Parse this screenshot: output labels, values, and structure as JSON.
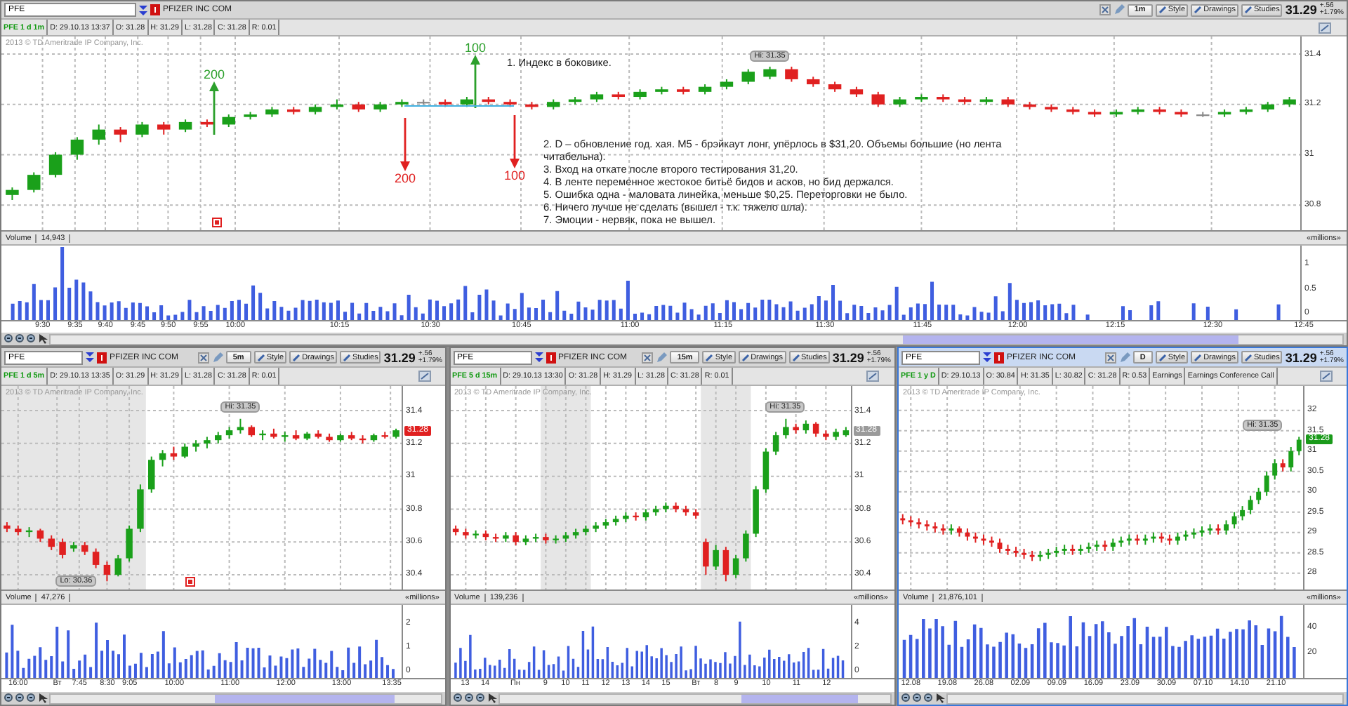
{
  "panels": [
    {
      "selected": false,
      "symbol": "PFE",
      "company": "PFIZER INC COM",
      "interval": "1m",
      "tools": [
        "Style",
        "Drawings",
        "Studies"
      ],
      "price": "31.29",
      "change": "+.56",
      "change_pct": "+1.79%",
      "info": [
        "PFE 1 d 1m",
        "D: 29.10.13 13:37",
        "O: 31.28",
        "H: 31.29",
        "L: 31.28",
        "C: 31.28",
        "R: 0.01"
      ],
      "copyright": "2013 © TD Ameritrade IP Company, Inc.",
      "hi_label": "Hi: 31.35",
      "chart_data": {
        "type": "candlestick",
        "grid": true,
        "ylim": [
          30.7,
          31.47
        ],
        "yticks": [
          31.4,
          31.2,
          31,
          30.8
        ],
        "categories": [
          null,
          null,
          null,
          null,
          null,
          null,
          null,
          null,
          null,
          null,
          null,
          null,
          null,
          null,
          null,
          null,
          null,
          null,
          null,
          null,
          null,
          null,
          null,
          null,
          null,
          null,
          null,
          null,
          null,
          null,
          null,
          null,
          null,
          null,
          null,
          null,
          null,
          null,
          null,
          null,
          null,
          null,
          null,
          null,
          null,
          null,
          null,
          null,
          null,
          null,
          null,
          null,
          null,
          null,
          null,
          null,
          null,
          null,
          null,
          null
        ],
        "ohlc": [
          [
            30.84,
            30.87,
            30.82,
            30.86
          ],
          [
            30.86,
            30.93,
            30.85,
            30.92
          ],
          [
            30.92,
            31.01,
            30.91,
            31.0
          ],
          [
            31.0,
            31.07,
            30.98,
            31.06
          ],
          [
            31.06,
            31.12,
            31.04,
            31.1
          ],
          [
            31.1,
            31.11,
            31.05,
            31.08
          ],
          [
            31.08,
            31.13,
            31.07,
            31.12
          ],
          [
            31.12,
            31.13,
            31.08,
            31.1
          ],
          [
            31.1,
            31.14,
            31.09,
            31.13
          ],
          [
            31.13,
            31.14,
            31.11,
            31.12
          ],
          [
            31.12,
            31.16,
            31.11,
            31.15
          ],
          [
            31.15,
            31.17,
            31.14,
            31.16
          ],
          [
            31.16,
            31.19,
            31.15,
            31.18
          ],
          [
            31.18,
            31.19,
            31.16,
            31.17
          ],
          [
            31.17,
            31.2,
            31.16,
            31.19
          ],
          [
            31.19,
            31.22,
            31.18,
            31.2
          ],
          [
            31.2,
            31.21,
            31.17,
            31.18
          ],
          [
            31.18,
            31.21,
            31.17,
            31.2
          ],
          [
            31.2,
            31.22,
            31.19,
            31.21
          ],
          [
            31.21,
            31.22,
            31.2,
            31.21
          ],
          [
            31.21,
            31.22,
            31.19,
            31.2
          ],
          [
            31.2,
            31.23,
            31.19,
            31.22
          ],
          [
            31.22,
            31.23,
            31.2,
            31.21
          ],
          [
            31.21,
            31.22,
            31.19,
            31.2
          ],
          [
            31.2,
            31.21,
            31.18,
            31.19
          ],
          [
            31.19,
            31.22,
            31.18,
            31.21
          ],
          [
            31.21,
            31.23,
            31.2,
            31.22
          ],
          [
            31.22,
            31.25,
            31.21,
            31.24
          ],
          [
            31.24,
            31.25,
            31.22,
            31.23
          ],
          [
            31.23,
            31.26,
            31.22,
            31.25
          ],
          [
            31.25,
            31.27,
            31.24,
            31.26
          ],
          [
            31.26,
            31.27,
            31.24,
            31.25
          ],
          [
            31.25,
            31.28,
            31.24,
            31.27
          ],
          [
            31.27,
            31.3,
            31.26,
            31.29
          ],
          [
            31.29,
            31.34,
            31.28,
            31.33
          ],
          [
            31.31,
            31.35,
            31.3,
            31.34
          ],
          [
            31.34,
            31.35,
            31.29,
            31.3
          ],
          [
            31.3,
            31.31,
            31.27,
            31.28
          ],
          [
            31.28,
            31.29,
            31.25,
            31.26
          ],
          [
            31.26,
            31.27,
            31.23,
            31.24
          ],
          [
            31.24,
            31.25,
            31.19,
            31.2
          ],
          [
            31.2,
            31.23,
            31.19,
            31.22
          ],
          [
            31.22,
            31.24,
            31.21,
            31.23
          ],
          [
            31.23,
            31.24,
            31.21,
            31.22
          ],
          [
            31.22,
            31.23,
            31.2,
            31.21
          ],
          [
            31.21,
            31.23,
            31.2,
            31.22
          ],
          [
            31.22,
            31.23,
            31.19,
            31.2
          ],
          [
            31.2,
            31.21,
            31.18,
            31.19
          ],
          [
            31.19,
            31.2,
            31.17,
            31.18
          ],
          [
            31.18,
            31.19,
            31.16,
            31.17
          ],
          [
            31.17,
            31.18,
            31.15,
            31.16
          ],
          [
            31.16,
            31.18,
            31.15,
            31.17
          ],
          [
            31.17,
            31.19,
            31.16,
            31.18
          ],
          [
            31.18,
            31.19,
            31.16,
            31.17
          ],
          [
            31.17,
            31.18,
            31.15,
            31.16
          ],
          [
            31.16,
            31.17,
            31.15,
            31.16
          ],
          [
            31.16,
            31.18,
            31.15,
            31.17
          ],
          [
            31.17,
            31.19,
            31.16,
            31.18
          ],
          [
            31.18,
            31.21,
            31.17,
            31.2
          ],
          [
            31.2,
            31.23,
            31.19,
            31.22
          ]
        ]
      },
      "volume_label": "Volume",
      "volume_value": "14,943",
      "volume_units": "«millions»",
      "volume_ticks": [
        "1",
        "0.5",
        "0"
      ],
      "time_ticks": [
        "9:30",
        "9:35",
        "9:40",
        "9:45",
        "9:50",
        "9:55",
        "10:00",
        "10:15",
        "10:30",
        "10:45",
        "11:00",
        "11:15",
        "11:30",
        "11:45",
        "12:00",
        "12:15",
        "12:30",
        "12:45"
      ],
      "arrows": [
        {
          "label": "200",
          "kind": "up",
          "color": "#2ca02c"
        },
        {
          "label": "100",
          "kind": "up",
          "color": "#2ca02c"
        },
        {
          "label": "200",
          "kind": "down",
          "color": "#e02020"
        },
        {
          "label": "100",
          "kind": "down",
          "color": "#e02020"
        }
      ],
      "notes": [
        "1. Индекс в боковике.",
        "2. D – обновление год. хая. M5 - брэйкаут лонг, упёрлось в $31,20. Объемы большие (но лента читабельна).",
        "3. Вход на откате после второго тестирования 31,20.",
        "4. В ленте переменное жестокое битьё бидов и асков, но бид держался.",
        "5. Ошибка одна - маловата линейка, меньше $0,25. Переторговки не было.",
        "6. Ничего лучше не сделать (вышел - т.к. тяжело шла).",
        "7. Эмоции - нервяк, пока не вышел."
      ]
    },
    {
      "selected": false,
      "symbol": "PFE",
      "company": "PFIZER INC COM",
      "interval": "5m",
      "tools": [
        "Style",
        "Drawings",
        "Studies"
      ],
      "price": "31.29",
      "change": "+.56",
      "change_pct": "+1.79%",
      "info": [
        "PFE 1 d 5m",
        "D: 29.10.13 13:35",
        "O: 31.29",
        "H: 31.29",
        "L: 31.28",
        "C: 31.28",
        "R: 0.01"
      ],
      "copyright": "2013 © TD Ameritrade IP Company, Inc.",
      "hi_label": "Hi: 31.35",
      "lo_label": "Lo: 30.36",
      "price_tag": {
        "text": "31.28",
        "color": "#e02020"
      },
      "chart_data": {
        "type": "candlestick",
        "grid": true,
        "ylim": [
          30.31,
          31.55
        ],
        "yticks": [
          31.4,
          31.2,
          31,
          30.8,
          30.6,
          30.4
        ],
        "categories": [
          null,
          null,
          null,
          null,
          null,
          null,
          null,
          null,
          null,
          null,
          null,
          null,
          null,
          null,
          null,
          null,
          null,
          null,
          null,
          null,
          null,
          null,
          null,
          null,
          null,
          null,
          null,
          null,
          null,
          null,
          null,
          null,
          null,
          null,
          null,
          null
        ],
        "ohlc": [
          [
            30.7,
            30.72,
            30.66,
            30.68
          ],
          [
            30.68,
            30.7,
            30.64,
            30.66
          ],
          [
            30.66,
            30.69,
            30.63,
            30.67
          ],
          [
            30.67,
            30.68,
            30.6,
            30.62
          ],
          [
            30.62,
            30.64,
            30.55,
            30.57
          ],
          [
            30.6,
            30.62,
            30.5,
            30.52
          ],
          [
            30.56,
            30.6,
            30.54,
            30.58
          ],
          [
            30.58,
            30.6,
            30.52,
            30.54
          ],
          [
            30.54,
            30.56,
            30.44,
            30.46
          ],
          [
            30.46,
            30.48,
            30.36,
            30.4
          ],
          [
            30.4,
            30.52,
            30.39,
            30.5
          ],
          [
            30.5,
            30.7,
            30.48,
            30.68
          ],
          [
            30.68,
            30.95,
            30.66,
            30.92
          ],
          [
            30.92,
            31.12,
            30.9,
            31.1
          ],
          [
            31.1,
            31.16,
            31.06,
            31.14
          ],
          [
            31.14,
            31.18,
            31.1,
            31.12
          ],
          [
            31.12,
            31.2,
            31.11,
            31.18
          ],
          [
            31.18,
            31.22,
            31.15,
            31.2
          ],
          [
            31.2,
            31.24,
            31.17,
            31.22
          ],
          [
            31.22,
            31.27,
            31.2,
            31.25
          ],
          [
            31.25,
            31.3,
            31.23,
            31.28
          ],
          [
            31.28,
            31.35,
            31.26,
            31.3
          ],
          [
            31.3,
            31.31,
            31.24,
            31.25
          ],
          [
            31.25,
            31.28,
            31.22,
            31.26
          ],
          [
            31.26,
            31.29,
            31.23,
            31.24
          ],
          [
            31.24,
            31.27,
            31.21,
            31.25
          ],
          [
            31.25,
            31.28,
            31.22,
            31.23
          ],
          [
            31.23,
            31.27,
            31.22,
            31.26
          ],
          [
            31.26,
            31.28,
            31.23,
            31.24
          ],
          [
            31.24,
            31.26,
            31.21,
            31.22
          ],
          [
            31.22,
            31.26,
            31.21,
            31.25
          ],
          [
            31.25,
            31.27,
            31.22,
            31.23
          ],
          [
            31.23,
            31.25,
            31.2,
            31.22
          ],
          [
            31.22,
            31.26,
            31.21,
            31.25
          ],
          [
            31.25,
            31.27,
            31.23,
            31.24
          ],
          [
            31.24,
            31.29,
            31.23,
            31.28
          ]
        ]
      },
      "volume_label": "Volume",
      "volume_value": "47,276",
      "volume_units": "«millions»",
      "volume_ticks": [
        "2",
        "1",
        "0"
      ],
      "time_ticks": [
        "16:00",
        "Вт",
        "7:45",
        "8:30",
        "9:05",
        "10:00",
        "11:00",
        "12:00",
        "13:00",
        "13:35"
      ]
    },
    {
      "selected": false,
      "symbol": "PFE",
      "company": "PFIZER INC COM",
      "interval": "15m",
      "tools": [
        "Style",
        "Drawings",
        "Studies"
      ],
      "price": "31.29",
      "change": "+.56",
      "change_pct": "+1.79%",
      "info": [
        "PFE 5 d 15m",
        "D: 29.10.13 13:30",
        "O: 31.28",
        "H: 31.29",
        "L: 31.28",
        "C: 31.28",
        "R: 0.01"
      ],
      "copyright": "2013 © TD Ameritrade IP Company, Inc.",
      "hi_label": "Hi: 31.35",
      "price_tag": {
        "text": "31.28",
        "color": "#9a9a9a"
      },
      "chart_data": {
        "type": "candlestick",
        "grid": true,
        "ylim": [
          30.31,
          31.55
        ],
        "yticks": [
          31.4,
          31.2,
          31,
          30.8,
          30.6,
          30.4
        ],
        "categories": [
          null,
          null,
          null,
          null,
          null,
          null,
          null,
          null,
          null,
          null,
          null,
          null,
          null,
          null,
          null,
          null,
          null,
          null,
          null,
          null,
          null,
          null,
          null,
          null,
          null,
          null,
          null,
          null,
          null,
          null,
          null,
          null,
          null,
          null,
          null,
          null,
          null,
          null,
          null,
          null
        ],
        "ohlc": [
          [
            30.68,
            30.7,
            30.64,
            30.66
          ],
          [
            30.66,
            30.68,
            30.62,
            30.64
          ],
          [
            30.64,
            30.67,
            30.62,
            30.65
          ],
          [
            30.65,
            30.67,
            30.61,
            30.63
          ],
          [
            30.63,
            30.65,
            30.6,
            30.62
          ],
          [
            30.62,
            30.66,
            30.6,
            30.64
          ],
          [
            30.64,
            30.66,
            30.58,
            30.6
          ],
          [
            30.6,
            30.64,
            30.58,
            30.62
          ],
          [
            30.62,
            30.65,
            30.6,
            30.63
          ],
          [
            30.63,
            30.65,
            30.59,
            30.61
          ],
          [
            30.61,
            30.64,
            30.59,
            30.62
          ],
          [
            30.62,
            30.66,
            30.6,
            30.64
          ],
          [
            30.64,
            30.68,
            30.62,
            30.66
          ],
          [
            30.66,
            30.7,
            30.64,
            30.68
          ],
          [
            30.68,
            30.72,
            30.66,
            30.7
          ],
          [
            30.7,
            30.74,
            30.68,
            30.72
          ],
          [
            30.72,
            30.76,
            30.7,
            30.74
          ],
          [
            30.74,
            30.78,
            30.72,
            30.76
          ],
          [
            30.76,
            30.78,
            30.73,
            30.75
          ],
          [
            30.75,
            30.8,
            30.73,
            30.78
          ],
          [
            30.78,
            30.82,
            30.76,
            30.8
          ],
          [
            30.8,
            30.84,
            30.78,
            30.82
          ],
          [
            30.82,
            30.84,
            30.78,
            30.8
          ],
          [
            30.8,
            30.82,
            30.76,
            30.78
          ],
          [
            30.78,
            30.8,
            30.74,
            30.76
          ],
          [
            30.6,
            30.62,
            30.4,
            30.45
          ],
          [
            30.45,
            30.58,
            30.43,
            30.55
          ],
          [
            30.55,
            30.57,
            30.36,
            30.4
          ],
          [
            30.4,
            30.52,
            30.38,
            30.5
          ],
          [
            30.5,
            30.67,
            30.48,
            30.65
          ],
          [
            30.65,
            30.94,
            30.63,
            30.92
          ],
          [
            30.92,
            31.17,
            30.9,
            31.15
          ],
          [
            31.15,
            31.27,
            31.13,
            31.25
          ],
          [
            31.25,
            31.35,
            31.23,
            31.3
          ],
          [
            31.3,
            31.32,
            31.26,
            31.28
          ],
          [
            31.28,
            31.34,
            31.26,
            31.32
          ],
          [
            31.32,
            31.33,
            31.24,
            31.26
          ],
          [
            31.26,
            31.28,
            31.22,
            31.24
          ],
          [
            31.24,
            31.29,
            31.22,
            31.27
          ],
          [
            31.25,
            31.3,
            31.24,
            31.28
          ]
        ]
      },
      "volume_label": "Volume",
      "volume_value": "139,236",
      "volume_units": "«millions»",
      "volume_ticks": [
        "4",
        "2",
        "0"
      ],
      "time_ticks": [
        "13",
        "14",
        "Пн",
        "9",
        "10",
        "11",
        "12",
        "13",
        "14",
        "15",
        "Вт",
        "8",
        "9",
        "10",
        "11",
        "12"
      ]
    },
    {
      "selected": true,
      "symbol": "PFE",
      "company": "PFIZER INC COM",
      "interval": "D",
      "tools": [
        "Style",
        "Drawings",
        "Studies"
      ],
      "price": "31.29",
      "change": "+.56",
      "change_pct": "+1.79%",
      "info": [
        "PFE 1 y D",
        "D: 29.10.13",
        "O: 30.84",
        "H: 31.35",
        "L: 30.82",
        "C: 31.28",
        "R: 0.53",
        "Earnings",
        "Earnings Conference Call"
      ],
      "copyright": "2013 © TD Ameritrade IP Company, Inc.",
      "hi_label": "Hi: 31.35",
      "price_tag": {
        "text": "31.28",
        "color": "#1a9a1a"
      },
      "chart_data": {
        "type": "candlestick",
        "grid": true,
        "ylim": [
          27.6,
          32.6
        ],
        "yticks": [
          32,
          31.5,
          31,
          30.5,
          30,
          29.5,
          29,
          28.5,
          28
        ],
        "categories": [
          null,
          null,
          null,
          null,
          null,
          null,
          null,
          null,
          null,
          null,
          null,
          null,
          null,
          null,
          null,
          null,
          null,
          null,
          null,
          null,
          null,
          null,
          null,
          null,
          null,
          null,
          null,
          null,
          null,
          null,
          null,
          null,
          null,
          null,
          null,
          null,
          null,
          null,
          null,
          null,
          null,
          null,
          null,
          null,
          null,
          null,
          null,
          null,
          null,
          null
        ],
        "ohlc": [
          [
            29.35,
            29.45,
            29.2,
            29.3
          ],
          [
            29.3,
            29.4,
            29.15,
            29.25
          ],
          [
            29.25,
            29.35,
            29.1,
            29.2
          ],
          [
            29.2,
            29.3,
            29.05,
            29.15
          ],
          [
            29.15,
            29.25,
            29.0,
            29.1
          ],
          [
            29.1,
            29.2,
            28.95,
            29.05
          ],
          [
            29.05,
            29.2,
            28.95,
            29.1
          ],
          [
            29.1,
            29.15,
            28.9,
            29.0
          ],
          [
            29.0,
            29.1,
            28.8,
            28.9
          ],
          [
            28.9,
            29.0,
            28.75,
            28.85
          ],
          [
            28.85,
            28.95,
            28.7,
            28.8
          ],
          [
            28.8,
            28.9,
            28.65,
            28.75
          ],
          [
            28.75,
            28.85,
            28.5,
            28.6
          ],
          [
            28.6,
            28.7,
            28.45,
            28.55
          ],
          [
            28.55,
            28.65,
            28.4,
            28.5
          ],
          [
            28.5,
            28.6,
            28.35,
            28.45
          ],
          [
            28.45,
            28.55,
            28.3,
            28.4
          ],
          [
            28.4,
            28.55,
            28.3,
            28.45
          ],
          [
            28.45,
            28.6,
            28.35,
            28.5
          ],
          [
            28.5,
            28.65,
            28.4,
            28.55
          ],
          [
            28.55,
            28.7,
            28.45,
            28.6
          ],
          [
            28.6,
            28.7,
            28.45,
            28.55
          ],
          [
            28.55,
            28.7,
            28.45,
            28.6
          ],
          [
            28.6,
            28.75,
            28.5,
            28.65
          ],
          [
            28.65,
            28.8,
            28.55,
            28.7
          ],
          [
            28.7,
            28.8,
            28.55,
            28.65
          ],
          [
            28.65,
            28.85,
            28.55,
            28.75
          ],
          [
            28.75,
            28.9,
            28.65,
            28.8
          ],
          [
            28.8,
            28.95,
            28.7,
            28.85
          ],
          [
            28.85,
            28.95,
            28.7,
            28.8
          ],
          [
            28.8,
            28.95,
            28.7,
            28.85
          ],
          [
            28.85,
            29.0,
            28.75,
            28.9
          ],
          [
            28.9,
            29.0,
            28.75,
            28.85
          ],
          [
            28.85,
            28.95,
            28.7,
            28.8
          ],
          [
            28.8,
            29.0,
            28.7,
            28.9
          ],
          [
            28.9,
            29.05,
            28.8,
            28.95
          ],
          [
            28.95,
            29.1,
            28.85,
            29.0
          ],
          [
            29.0,
            29.15,
            28.9,
            29.05
          ],
          [
            29.05,
            29.2,
            28.95,
            29.1
          ],
          [
            29.1,
            29.2,
            28.95,
            29.05
          ],
          [
            29.05,
            29.3,
            28.95,
            29.2
          ],
          [
            29.2,
            29.5,
            29.1,
            29.4
          ],
          [
            29.4,
            29.65,
            29.3,
            29.55
          ],
          [
            29.55,
            29.9,
            29.45,
            29.8
          ],
          [
            29.8,
            30.1,
            29.7,
            30.0
          ],
          [
            30.0,
            30.5,
            29.9,
            30.4
          ],
          [
            30.4,
            30.8,
            30.3,
            30.7
          ],
          [
            30.7,
            30.8,
            30.5,
            30.6
          ],
          [
            30.6,
            31.1,
            30.5,
            31.0
          ],
          [
            31.0,
            31.35,
            30.9,
            31.28
          ]
        ]
      },
      "volume_label": "Volume",
      "volume_value": "21,876,101",
      "volume_units": "«millions»",
      "volume_ticks": [
        "40",
        "20"
      ],
      "time_ticks": [
        "12.08",
        "19.08",
        "26.08",
        "02.09",
        "09.09",
        "16.09",
        "23.09",
        "30.09",
        "07.10",
        "14.10",
        "21.10"
      ]
    }
  ]
}
